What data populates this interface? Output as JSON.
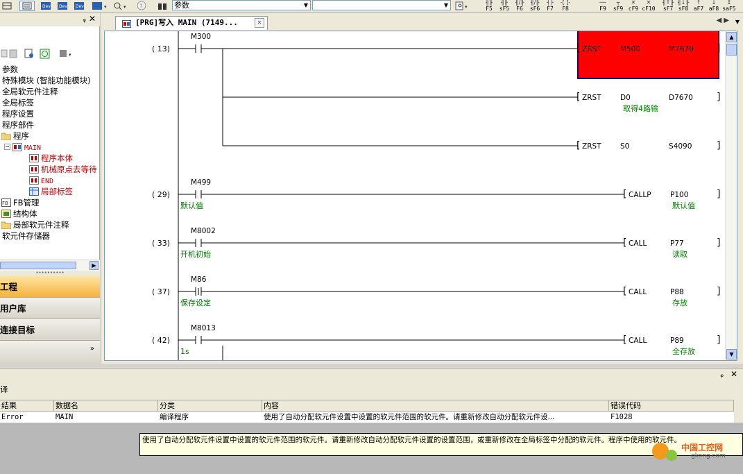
{
  "toolbar": {
    "search_combo": "参数",
    "fkeys": [
      {
        "glyph": "╢╟",
        "label": "F5"
      },
      {
        "glyph": "╢╟",
        "label": "sF5"
      },
      {
        "glyph": "╢/╟",
        "label": "F6"
      },
      {
        "glyph": "╢/╟",
        "label": "sF6"
      },
      {
        "glyph": "┤├",
        "label": "F7"
      },
      {
        "glyph": "-[ ]-",
        "label": "F8"
      },
      {
        "glyph": "──",
        "label": "F9"
      },
      {
        "glyph": "┬",
        "label": "sF9"
      },
      {
        "glyph": "✕",
        "label": "cF9"
      },
      {
        "glyph": "✕",
        "label": "cF10"
      },
      {
        "glyph": "╢↑╟",
        "label": "sF7"
      },
      {
        "glyph": "╢↓╟",
        "label": "sF8"
      },
      {
        "glyph": "↑",
        "label": "aF7"
      },
      {
        "glyph": "↓",
        "label": "aF8"
      },
      {
        "glyph": "↕",
        "label": "saF5"
      }
    ]
  },
  "nav": {
    "tree": [
      {
        "label": "参数",
        "indent": 0,
        "color": "black",
        "icon": "none",
        "mono": false
      },
      {
        "label": "特殊模块 (智能功能模块)",
        "indent": 0,
        "color": "black",
        "icon": "none",
        "mono": false
      },
      {
        "label": "全局软元件注释",
        "indent": 0,
        "color": "black",
        "icon": "none",
        "mono": false
      },
      {
        "label": "全局标签",
        "indent": 0,
        "color": "black",
        "icon": "none",
        "mono": false
      },
      {
        "label": "程序设置",
        "indent": 0,
        "color": "black",
        "icon": "none",
        "mono": false
      },
      {
        "label": "程序部件",
        "indent": 0,
        "color": "black",
        "icon": "none",
        "mono": false
      },
      {
        "label": "程序",
        "indent": 1,
        "color": "black",
        "icon": "folder-icon",
        "mono": false
      },
      {
        "label": "MAIN",
        "indent": 2,
        "color": "red",
        "icon": "program-icon",
        "mono": true
      },
      {
        "label": "程序本体",
        "indent": 3,
        "color": "red",
        "icon": "ladder-icon",
        "mono": false
      },
      {
        "label": "机械原点去等待",
        "indent": 3,
        "color": "red",
        "icon": "ladder-icon",
        "mono": false
      },
      {
        "label": "END",
        "indent": 3,
        "color": "red",
        "icon": "ladder-icon",
        "mono": true
      },
      {
        "label": "局部标签",
        "indent": 3,
        "color": "red",
        "icon": "table-icon",
        "mono": false
      },
      {
        "label": "FB管理",
        "indent": 1,
        "color": "black",
        "icon": "fb-icon",
        "mono": false
      },
      {
        "label": "结构体",
        "indent": 1,
        "color": "black",
        "icon": "struct-icon",
        "mono": false
      },
      {
        "label": "局部软元件注释",
        "indent": 1,
        "color": "black",
        "icon": "folder-icon",
        "mono": false
      },
      {
        "label": "软元件存储器",
        "indent": 0,
        "color": "black",
        "icon": "none",
        "mono": false
      }
    ],
    "project": "工程",
    "userlib": "用户库",
    "target": "连接目标",
    "more": "»"
  },
  "tab": {
    "label": "[PRG]写入 MAIN (7149...",
    "close": "✕"
  },
  "ladder": {
    "rungs": [
      {
        "step": "( 13)",
        "contacts": [
          {
            "dev": "M300",
            "type": "NO",
            "comment": ""
          }
        ],
        "instrs": [
          {
            "op": "ZRST",
            "a": "M500",
            "b": "M7670",
            "acomment": "",
            "bcomment": "",
            "highlight": true
          },
          {
            "op": "ZRST",
            "a": "D0",
            "b": "D7670",
            "acomment": "取得4路输",
            "bcomment": "",
            "highlight": false
          },
          {
            "op": "ZRST",
            "a": "S0",
            "b": "S4090",
            "acomment": "",
            "bcomment": "",
            "highlight": false
          }
        ]
      },
      {
        "step": "( 29)",
        "contacts": [
          {
            "dev": "M499",
            "type": "NO",
            "comment": "默认值"
          }
        ],
        "instrs": [
          {
            "op": "CALLP",
            "a": "P100",
            "b": "",
            "acomment": "默认值",
            "bcomment": "",
            "highlight": false
          }
        ]
      },
      {
        "step": "( 33)",
        "contacts": [
          {
            "dev": "M8002",
            "type": "NO",
            "comment": "开机初始"
          }
        ],
        "instrs": [
          {
            "op": "CALL",
            "a": "P77",
            "b": "",
            "acomment": "读取",
            "bcomment": "",
            "highlight": false
          }
        ]
      },
      {
        "step": "( 37)",
        "contacts": [
          {
            "dev": "M86",
            "type": "PULSE",
            "comment": "保存设定"
          }
        ],
        "instrs": [
          {
            "op": "CALL",
            "a": "P88",
            "b": "",
            "acomment": "存放",
            "bcomment": "",
            "highlight": false
          }
        ]
      },
      {
        "step": "( 42)",
        "contacts": [
          {
            "dev": "M8013",
            "type": "NO",
            "comment": "1s"
          }
        ],
        "instrs": [
          {
            "op": "CALL",
            "a": "P89",
            "b": "",
            "acomment": "全存放",
            "bcomment": "",
            "highlight": false
          }
        ]
      }
    ]
  },
  "output": {
    "subtitle": "译",
    "columns": [
      "结果",
      "数据名",
      "分类",
      "内容",
      "错误代码"
    ],
    "row": [
      "Error",
      "MAIN",
      "编译程序",
      "使用了自动分配软元件设置中设置的软元件范围的软元件。请重新修改自动分配软元件设...",
      "F1028"
    ],
    "tooltip": "使用了自动分配软元件设置中设置的软元件范围的软元件。请重新修改自动分配软元件设置的设置范围，或重新修改在全局标签中分配的软元件。程序中使用的软元件。",
    "watermark_brand": "中国工控网",
    "watermark_url": "gkong.com"
  },
  "colors": {
    "highlight": "#ff0000",
    "ladder_line": "#000000",
    "comment": "#008000",
    "tree_red": "#c00000"
  }
}
